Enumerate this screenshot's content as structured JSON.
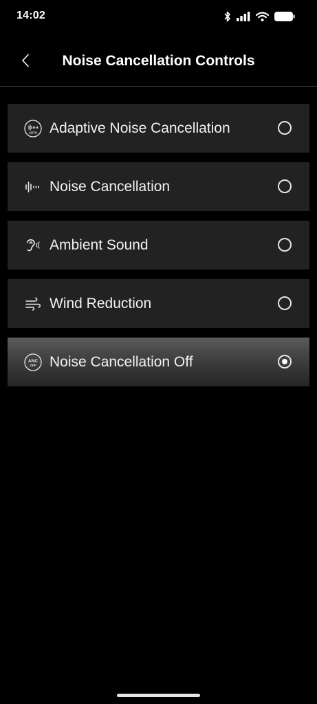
{
  "status_bar": {
    "time": "14:02",
    "icons": [
      "bluetooth-icon",
      "cellular-signal-icon",
      "wifi-icon",
      "battery-icon"
    ]
  },
  "header": {
    "back_icon": "chevron-left-icon",
    "title": "Noise Cancellation Controls"
  },
  "options": [
    {
      "label": "Adaptive Noise Cancellation",
      "icon": "adaptive-anc-icon",
      "icon_text": "AUTO",
      "selected": false
    },
    {
      "label": "Noise Cancellation",
      "icon": "noise-cancellation-icon",
      "selected": false
    },
    {
      "label": "Ambient Sound",
      "icon": "ambient-sound-icon",
      "selected": false
    },
    {
      "label": "Wind Reduction",
      "icon": "wind-reduction-icon",
      "selected": false
    },
    {
      "label": "Noise Cancellation Off",
      "icon": "anc-off-icon",
      "icon_text_top": "ANC",
      "icon_text_bottom": "OFF",
      "selected": true
    }
  ],
  "colors": {
    "background": "#000000",
    "option_background": "#222222",
    "selected_background": "#474747",
    "text": "#f2f2f2"
  }
}
